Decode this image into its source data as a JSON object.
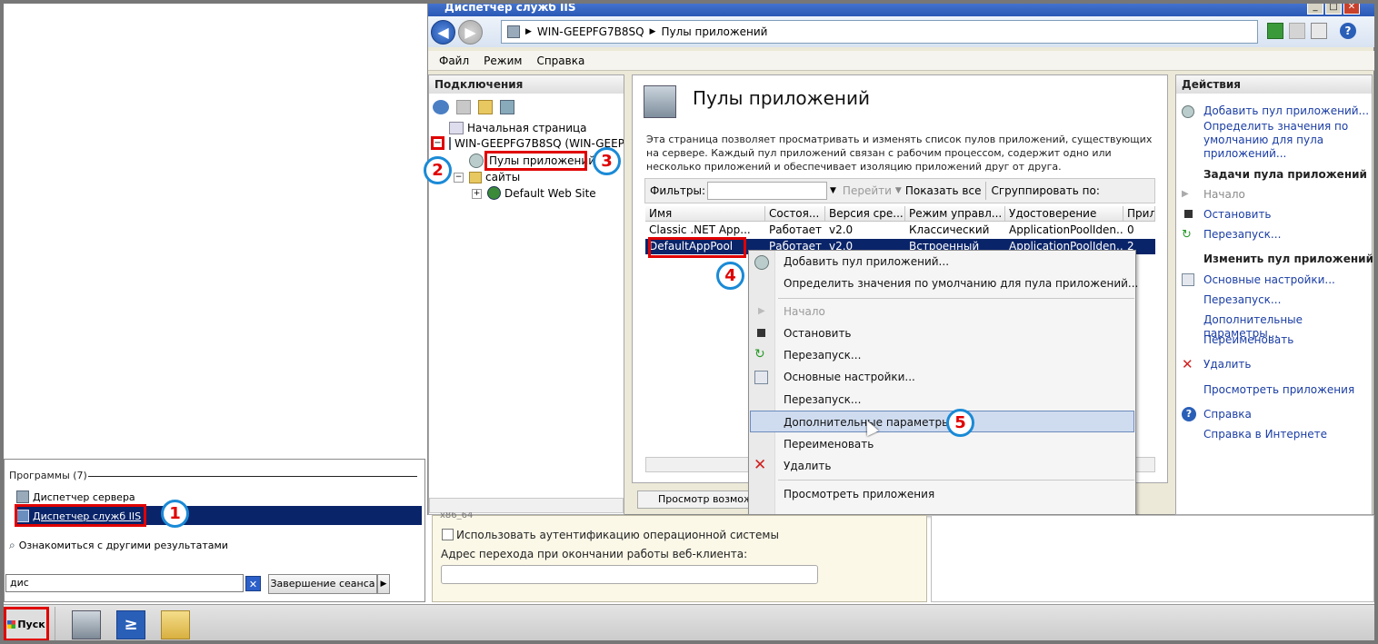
{
  "start_menu": {
    "programs_header": "Программы (7)",
    "items": [
      {
        "label": "Диспетчер сервера"
      },
      {
        "label": "Диспетчер служб IIS"
      }
    ],
    "more_results": "Ознакомиться с другими результатами",
    "search_value": "дис",
    "logoff_label": "Завершение сеанса",
    "start_label": "Пуск"
  },
  "window": {
    "title": "Диспетчер служб IIS",
    "address": [
      "WIN-GEEPFG7B8SQ",
      "Пулы приложений"
    ],
    "menu": [
      "Файл",
      "Режим",
      "Справка"
    ]
  },
  "connections": {
    "header": "Подключения",
    "tree": [
      {
        "label": "Начальная страница"
      },
      {
        "label": "WIN-GEEPFG7B8SQ (WIN-GEEPF"
      },
      {
        "label": "Пулы приложений"
      },
      {
        "label": "сайты"
      },
      {
        "label": "Default Web Site"
      }
    ]
  },
  "main": {
    "title": "Пулы приложений",
    "description": "Эта страница позволяет просматривать и изменять список пулов приложений, существующих на сервере. Каждый пул приложений связан с рабочим процессом, содержит одно или несколько приложений и обеспечивает изоляцию приложений друг от друга.",
    "filter_label": "Фильтры:",
    "go_label": "Перейти",
    "show_all_label": "Показать все",
    "group_label": "Сгруппировать по:",
    "columns": [
      "Имя",
      "Состоя...",
      "Версия сре...",
      "Режим управл...",
      "Удостоверение",
      "Прил"
    ],
    "rows": [
      [
        "Classic .NET App...",
        "Работает",
        "v2.0",
        "Классический",
        "ApplicationPoolIden...",
        "0"
      ],
      [
        "DefaultAppPool",
        "Работает",
        "v2.0",
        "Встроенный",
        "ApplicationPoolIden...",
        "2"
      ]
    ],
    "features_view": "Просмотр возможн"
  },
  "context_menu": {
    "items": [
      {
        "label": "Добавить пул приложений...",
        "disabled": false
      },
      {
        "label": "Определить значения по умолчанию для пула приложений...",
        "disabled": false
      },
      {
        "label": "Начало",
        "disabled": true
      },
      {
        "label": "Остановить",
        "disabled": false
      },
      {
        "label": "Перезапуск...",
        "disabled": false
      },
      {
        "label": "Основные настройки...",
        "disabled": false
      },
      {
        "label": "Перезапуск...",
        "disabled": false
      },
      {
        "label": "Дополнительные параметры...",
        "disabled": false
      },
      {
        "label": "Переименовать",
        "disabled": false
      },
      {
        "label": "Удалить",
        "disabled": false
      },
      {
        "label": "Просмотреть приложения",
        "disabled": false
      }
    ]
  },
  "actions": {
    "header": "Действия",
    "top_links": [
      "Добавить пул приложений...",
      "Определить значения по умолчанию для пула приложений..."
    ],
    "task_header": "Задачи пула приложений",
    "task_links": [
      "Начало",
      "Остановить",
      "Перезапуск..."
    ],
    "edit_header": "Изменить пул приложений",
    "edit_links": [
      "Основные настройки...",
      "Перезапуск...",
      "Дополнительные параметры...",
      "Переименовать"
    ],
    "delete": "Удалить",
    "view_apps": "Просмотреть приложения",
    "help": "Справка",
    "help_online": "Справка в Интернете"
  },
  "dialog": {
    "fragment": "x86_64",
    "checkbox_label": "Использовать аутентификацию операционной системы",
    "field_label": "Адрес перехода при окончании работы веб-клиента:"
  },
  "steps": [
    "1",
    "2",
    "3",
    "4",
    "5"
  ],
  "colors": {
    "highlight_red": "#e00000",
    "step_circle": "#1a8ad6",
    "selection": "#0a246a"
  }
}
